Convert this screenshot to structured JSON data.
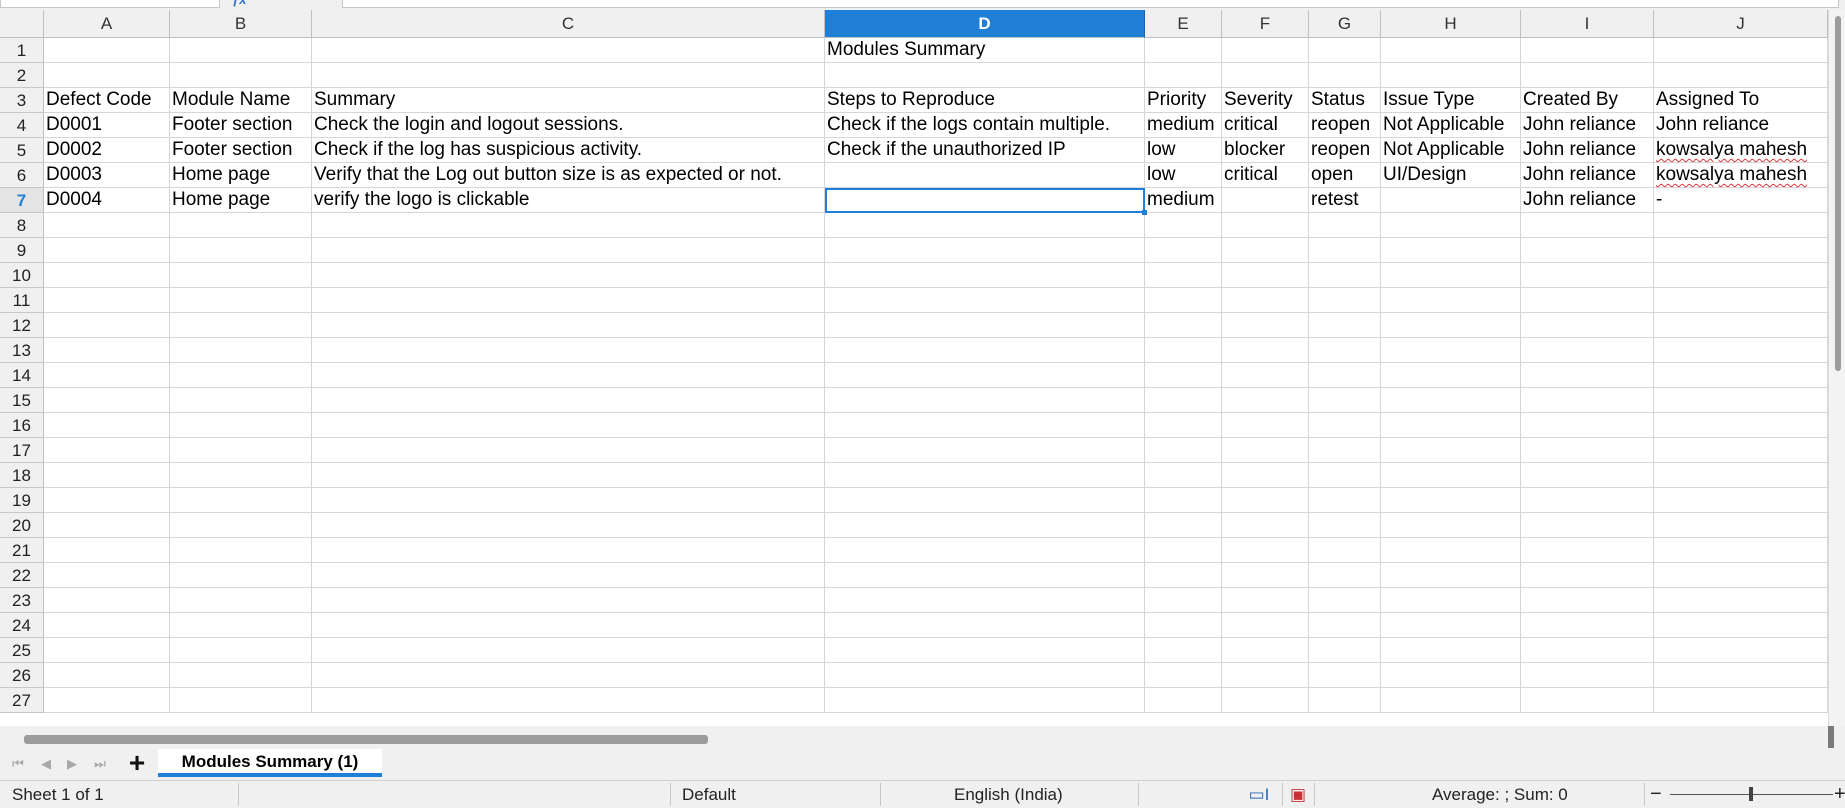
{
  "columns": [
    "A",
    "B",
    "C",
    "D",
    "E",
    "F",
    "G",
    "H",
    "I",
    "J"
  ],
  "selected_column": "D",
  "rows": [
    "1",
    "2",
    "3",
    "4",
    "5",
    "6",
    "7",
    "8",
    "9",
    "10",
    "11",
    "12",
    "13",
    "14",
    "15",
    "16",
    "17",
    "18",
    "19",
    "20",
    "21",
    "22",
    "23",
    "24",
    "25",
    "26",
    "27"
  ],
  "selected_row": "7",
  "cells": {
    "title": "Modules Summary",
    "headers": [
      "Defect Code",
      "Module Name",
      "Summary",
      "Steps to Reproduce",
      "Priority",
      "Severity",
      "Status",
      "Issue Type",
      "Created By",
      "Assigned To"
    ],
    "data": [
      [
        "D0001",
        "Footer section",
        "Check the login and logout sessions.",
        "Check if the logs contain multiple.",
        "medium",
        "critical",
        "reopen",
        "Not Applicable",
        "John reliance",
        "John reliance"
      ],
      [
        "D0002",
        "Footer section",
        "Check if the log has suspicious activity.",
        "Check if the unauthorized IP",
        "low",
        "blocker",
        "reopen",
        "Not Applicable",
        "John reliance",
        "kowsalya mahesh"
      ],
      [
        "D0003",
        "Home page",
        "Verify that the Log out button size is as expected or not.",
        "",
        "low",
        "critical",
        "open",
        "UI/Design",
        "John reliance",
        "kowsalya mahesh"
      ],
      [
        "D0004",
        "Home page",
        "verify the logo is clickable",
        "",
        "medium",
        "",
        "retest",
        "",
        "John reliance",
        "-"
      ]
    ]
  },
  "sheet_tabs": [
    "Modules Summary (1)"
  ],
  "status": {
    "sheet": "Sheet 1 of 1",
    "page_style": "Default",
    "language": "English (India)",
    "summary": "Average: ; Sum: 0"
  },
  "colors": {
    "accent": "#1f7fd6",
    "header_bg": "#f0f0f0",
    "spellcheck": "#e0393e"
  }
}
